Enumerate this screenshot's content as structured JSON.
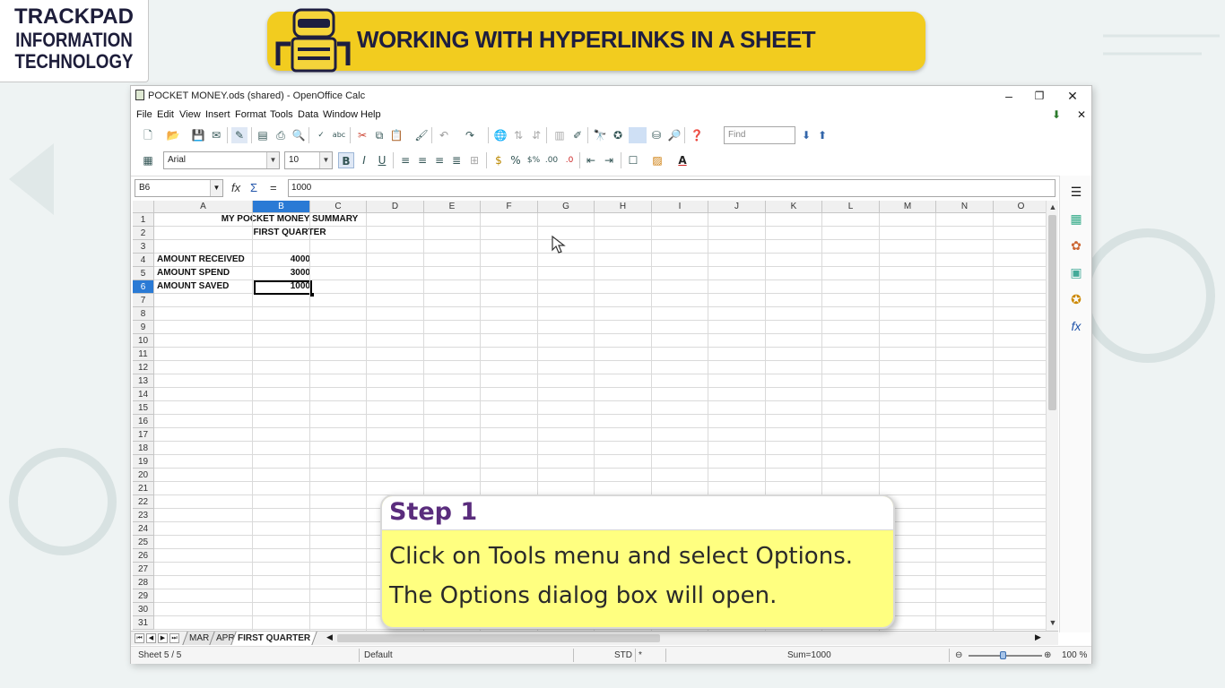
{
  "brand": {
    "line1": "TRACKPAD",
    "line2": "INFORMATION",
    "line3": "TECHNOLOGY"
  },
  "banner": {
    "title": "WORKING WITH HYPERLINKS IN A SHEET",
    "color": "#f2cc1f"
  },
  "window": {
    "title": "POCKET MONEY.ods (shared) - OpenOffice Calc",
    "buttons": {
      "minimize": "–",
      "maximize": "❐",
      "close": "✕"
    }
  },
  "menu": {
    "items": [
      "File",
      "Edit",
      "View",
      "Insert",
      "Format",
      "Tools",
      "Data",
      "Window",
      "Help"
    ],
    "close_doc": "✕"
  },
  "toolbar2": {
    "font_name": "Arial",
    "font_size": "10",
    "bold": "B",
    "italic": "I",
    "underline": "U"
  },
  "find": {
    "placeholder": "Find"
  },
  "formula_bar": {
    "name_box": "B6",
    "fx": "fx",
    "sum": "Σ",
    "equals": "=",
    "content": "1000"
  },
  "sheet": {
    "columns": [
      "A",
      "B",
      "C",
      "D",
      "E",
      "F",
      "G",
      "H",
      "I",
      "J",
      "K",
      "L",
      "M",
      "N",
      "O"
    ],
    "active_column": "B",
    "active_row": 6,
    "rows": [
      "1",
      "2",
      "3",
      "4",
      "5",
      "6",
      "7",
      "8",
      "9",
      "10",
      "11",
      "12",
      "13",
      "14",
      "15",
      "16",
      "17",
      "18",
      "19",
      "20",
      "21",
      "22",
      "23",
      "24",
      "25",
      "26",
      "27",
      "28",
      "29",
      "30",
      "31"
    ],
    "cells": {
      "title": "MY POCKET MONEY SUMMARY",
      "subtitle": "FIRST QUARTER",
      "a4": "AMOUNT RECEIVED",
      "b4": "4000",
      "a5": "AMOUNT SPEND",
      "b5": "3000",
      "a6": "AMOUNT SAVED",
      "b6": "1000"
    }
  },
  "tabs": {
    "items": [
      "MAR",
      "APR",
      "FIRST QUARTER"
    ],
    "active": "FIRST QUARTER"
  },
  "status": {
    "sheet": "Sheet 5 / 5",
    "style": "Default",
    "mode": "STD",
    "star": "*",
    "sum": "Sum=1000",
    "zoom": "100 %"
  },
  "step": {
    "title": "Step 1",
    "line1": "Click on Tools menu and select Options.",
    "line2": "The Options dialog box will open."
  }
}
